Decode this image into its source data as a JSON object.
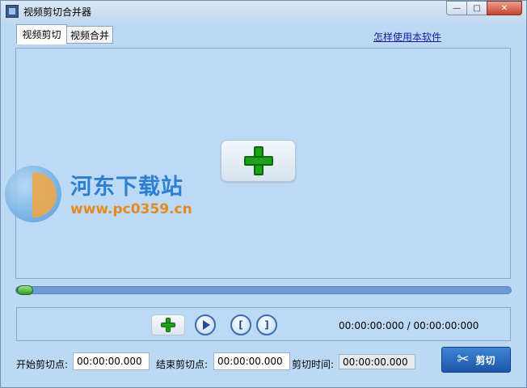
{
  "window": {
    "title": "视频剪切合并器",
    "icon": "film-icon"
  },
  "tabs": [
    {
      "label": "视频剪切",
      "active": true
    },
    {
      "label": "视频合并",
      "active": false
    }
  ],
  "help_link": "怎样使用本软件",
  "watermark": {
    "name": "河东下载站",
    "url": "www.pc0359.cn"
  },
  "video_area": {
    "add_icon": "plus-icon"
  },
  "progress": {
    "value": 0.02
  },
  "controls": {
    "add_icon": "plus-icon",
    "play_icon": "play-icon",
    "mark_start_label": "[",
    "mark_end_label": "]",
    "time_display": "00:00:00:000 / 00:00:00:000"
  },
  "fields": {
    "start_label": "开始剪切点:",
    "start_value": "00:00:00.000",
    "end_label": "结束剪切点:",
    "end_value": "00:00:00.000",
    "duration_label": "剪切时间:",
    "duration_value": "00:00:00.000"
  },
  "cut_button": {
    "label": "剪切",
    "icon": "scissors-icon"
  },
  "colors": {
    "accent": "#1c57a8",
    "green": "#1ea21a",
    "background": "#bcd9f3"
  }
}
